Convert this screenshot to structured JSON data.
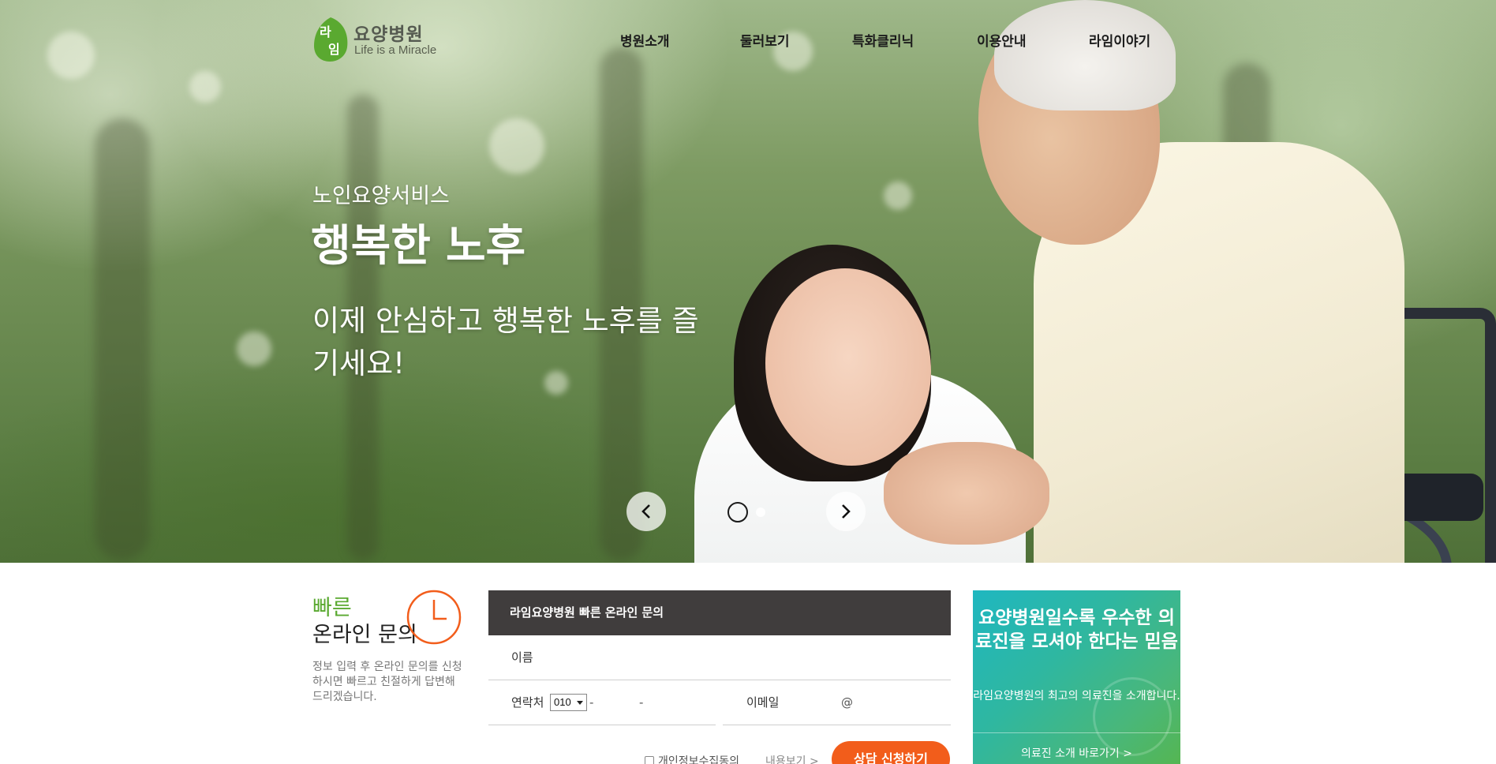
{
  "header": {
    "logo_name": "요양병원",
    "logo_mark_text": "라임",
    "logo_tagline": "Life is a Miracle",
    "nav": [
      "병원소개",
      "둘러보기",
      "특화클리닉",
      "이용안내",
      "라임이야기"
    ]
  },
  "hero": {
    "subtitle": "노인요양서비스",
    "title": "행복한 노후",
    "description": "이제 안심하고 행복한 노후를 즐기세요!",
    "slides_total": 2,
    "slide_active": 1
  },
  "quick_inquiry": {
    "title_line1": "빠른",
    "title_line2": "온라인 문의",
    "description": "정보 입력 후 온라인 문의를 신청하시면 빠르고 친절하게 답변해 드리겠습니다.",
    "form_header": "라임요양병원 빠른 온라인 문의",
    "name_label": "이름",
    "name_value": "",
    "phone_label": "연락처",
    "phone_prefix": "010",
    "phone_dash": "-",
    "phone_mid_value": "",
    "phone_last_value": "",
    "email_label": "이메일",
    "email_at": "@",
    "email_user_value": "",
    "email_domain_value": "",
    "agree_label": "개인정보수집동의",
    "view_link": "내용보기 >",
    "submit_label": "상담 신청하기"
  },
  "promo": {
    "title": "요양병원일수록 우수한 의료진을 모셔야 한다는 믿음",
    "description": "라임요양병원의 최고의 의료진을 소개합니다.",
    "link": "의료진 소개 바로가기 >"
  },
  "colors": {
    "brand_green": "#5aa930",
    "accent_orange": "#f25d1b",
    "form_header_bg": "#403d3d",
    "promo_teal": "#1fb7c0",
    "promo_green": "#55b652"
  },
  "icons": [
    "chevron-left-icon",
    "chevron-right-icon",
    "clock-icon",
    "magnifier-icon"
  ]
}
